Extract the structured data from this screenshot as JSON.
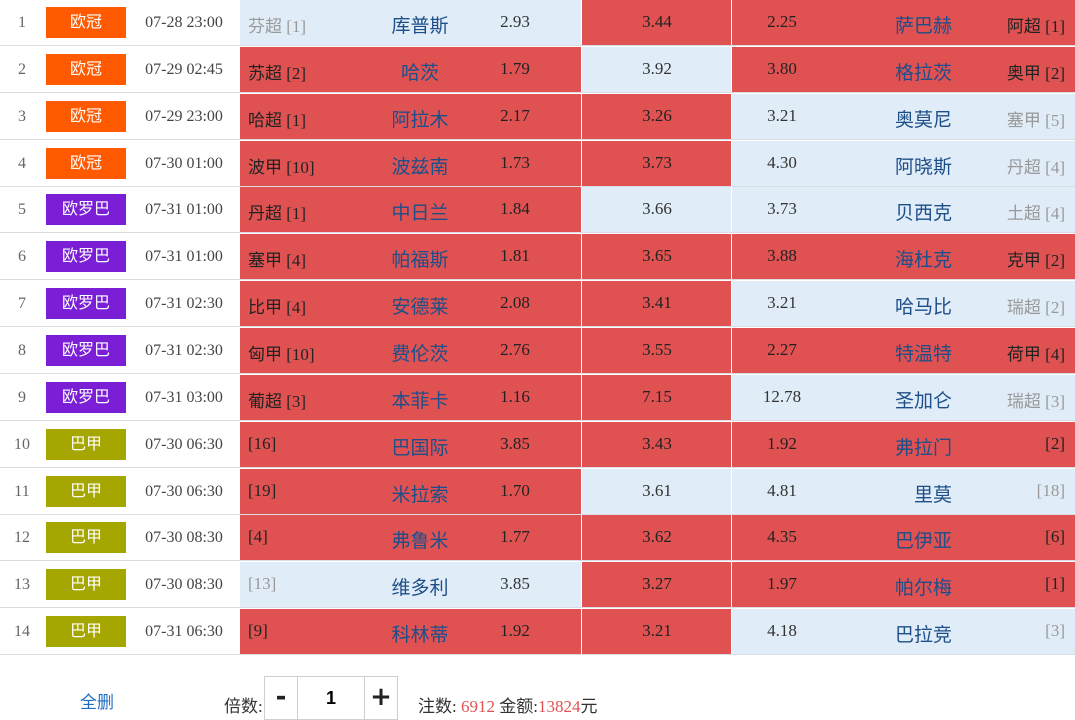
{
  "colors": {
    "selected_cell": "#e05252",
    "unselected_cell": "#e0edf8",
    "league_europe": "#ff5a00",
    "league_europa": "#7a1fd6",
    "league_brazil": "#a6a600",
    "accent_number": "#e05252",
    "link": "#1e6cc4"
  },
  "matches": [
    {
      "no": "1",
      "league": "欧冠",
      "league_color": "#ff5a00",
      "time": "07-28 23:00",
      "home_rank": "芬超 [1]",
      "home": "库普斯",
      "home_odd": "2.93",
      "draw_odd": "3.44",
      "away_odd": "2.25",
      "away": "萨巴赫",
      "away_rank": "阿超 [1]",
      "sel": [
        false,
        true,
        true
      ]
    },
    {
      "no": "2",
      "league": "欧冠",
      "league_color": "#ff5a00",
      "time": "07-29 02:45",
      "home_rank": "苏超 [2]",
      "home": "哈茨",
      "home_odd": "1.79",
      "draw_odd": "3.92",
      "away_odd": "3.80",
      "away": "格拉茨",
      "away_rank": "奥甲 [2]",
      "sel": [
        true,
        false,
        true
      ]
    },
    {
      "no": "3",
      "league": "欧冠",
      "league_color": "#ff5a00",
      "time": "07-29 23:00",
      "home_rank": "哈超 [1]",
      "home": "阿拉木",
      "home_odd": "2.17",
      "draw_odd": "3.26",
      "away_odd": "3.21",
      "away": "奥莫尼",
      "away_rank": "塞甲 [5]",
      "sel": [
        true,
        true,
        false
      ]
    },
    {
      "no": "4",
      "league": "欧冠",
      "league_color": "#ff5a00",
      "time": "07-30 01:00",
      "home_rank": "波甲 [10]",
      "home": "波兹南",
      "home_odd": "1.73",
      "draw_odd": "3.73",
      "away_odd": "4.30",
      "away": "阿晓斯",
      "away_rank": "丹超 [4]",
      "sel": [
        true,
        true,
        false
      ]
    },
    {
      "no": "5",
      "league": "欧罗巴",
      "league_color": "#7a1fd6",
      "time": "07-31 01:00",
      "home_rank": "丹超 [1]",
      "home": "中日兰",
      "home_odd": "1.84",
      "draw_odd": "3.66",
      "away_odd": "3.73",
      "away": "贝西克",
      "away_rank": "土超 [4]",
      "sel": [
        true,
        false,
        false
      ]
    },
    {
      "no": "6",
      "league": "欧罗巴",
      "league_color": "#7a1fd6",
      "time": "07-31 01:00",
      "home_rank": "塞甲 [4]",
      "home": "帕福斯",
      "home_odd": "1.81",
      "draw_odd": "3.65",
      "away_odd": "3.88",
      "away": "海杜克",
      "away_rank": "克甲 [2]",
      "sel": [
        true,
        true,
        true
      ]
    },
    {
      "no": "7",
      "league": "欧罗巴",
      "league_color": "#7a1fd6",
      "time": "07-31 02:30",
      "home_rank": "比甲 [4]",
      "home": "安德莱",
      "home_odd": "2.08",
      "draw_odd": "3.41",
      "away_odd": "3.21",
      "away": "哈马比",
      "away_rank": "瑞超 [2]",
      "sel": [
        true,
        true,
        false
      ]
    },
    {
      "no": "8",
      "league": "欧罗巴",
      "league_color": "#7a1fd6",
      "time": "07-31 02:30",
      "home_rank": "匈甲 [10]",
      "home": "费伦茨",
      "home_odd": "2.76",
      "draw_odd": "3.55",
      "away_odd": "2.27",
      "away": "特温特",
      "away_rank": "荷甲 [4]",
      "sel": [
        true,
        true,
        true
      ]
    },
    {
      "no": "9",
      "league": "欧罗巴",
      "league_color": "#7a1fd6",
      "time": "07-31 03:00",
      "home_rank": "葡超 [3]",
      "home": "本菲卡",
      "home_odd": "1.16",
      "draw_odd": "7.15",
      "away_odd": "12.78",
      "away": "圣加仑",
      "away_rank": "瑞超 [3]",
      "sel": [
        true,
        true,
        false
      ]
    },
    {
      "no": "10",
      "league": "巴甲",
      "league_color": "#a6a600",
      "time": "07-30 06:30",
      "home_rank": "[16]",
      "home": "巴国际",
      "home_odd": "3.85",
      "draw_odd": "3.43",
      "away_odd": "1.92",
      "away": "弗拉门",
      "away_rank": "[2]",
      "sel": [
        true,
        true,
        true
      ]
    },
    {
      "no": "11",
      "league": "巴甲",
      "league_color": "#a6a600",
      "time": "07-30 06:30",
      "home_rank": "[19]",
      "home": "米拉索",
      "home_odd": "1.70",
      "draw_odd": "3.61",
      "away_odd": "4.81",
      "away": "里莫",
      "away_rank": "[18]",
      "sel": [
        true,
        false,
        false
      ]
    },
    {
      "no": "12",
      "league": "巴甲",
      "league_color": "#a6a600",
      "time": "07-30 08:30",
      "home_rank": "[4]",
      "home": "弗鲁米",
      "home_odd": "1.77",
      "draw_odd": "3.62",
      "away_odd": "4.35",
      "away": "巴伊亚",
      "away_rank": "[6]",
      "sel": [
        true,
        true,
        true
      ]
    },
    {
      "no": "13",
      "league": "巴甲",
      "league_color": "#a6a600",
      "time": "07-30 08:30",
      "home_rank": "[13]",
      "home": "维多利",
      "home_odd": "3.85",
      "draw_odd": "3.27",
      "away_odd": "1.97",
      "away": "帕尔梅",
      "away_rank": "[1]",
      "sel": [
        false,
        true,
        true
      ]
    },
    {
      "no": "14",
      "league": "巴甲",
      "league_color": "#a6a600",
      "time": "07-31 06:30",
      "home_rank": "[9]",
      "home": "科林蒂",
      "home_odd": "1.92",
      "draw_odd": "3.21",
      "away_odd": "4.18",
      "away": "巴拉竞",
      "away_rank": "[3]",
      "sel": [
        true,
        true,
        false
      ]
    }
  ],
  "footer": {
    "clear_all": "全删",
    "multiplier_label": "倍数:",
    "minus": "-",
    "plus": "+",
    "multiplier_value": "1",
    "bets_label": "注数:",
    "bets_value": "6912",
    "amount_label": "金额:",
    "amount_value": "13824",
    "currency": "元"
  }
}
